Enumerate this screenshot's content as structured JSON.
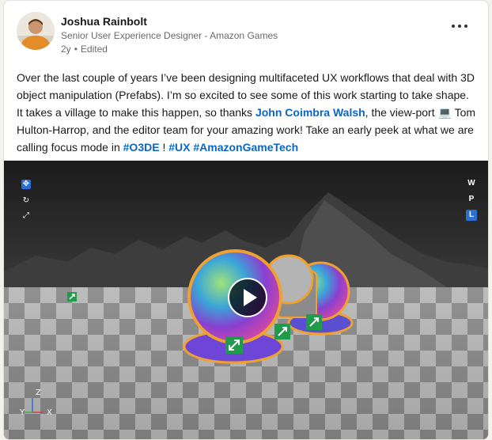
{
  "post": {
    "author_name": "Joshua Rainbolt",
    "author_title": "Senior User Experience Designer - Amazon Games",
    "age": "2y",
    "edited": "Edited",
    "meta_separator": "•",
    "more_menu_icon": "ellipsis-icon",
    "text": {
      "p1": "Over the last couple of years I’ve been designing multifaceted UX workflows that deal with 3D object manipulation (Prefabs). I’m so excited to see some of this work starting to take shape. It takes a village to make this happen, so thanks ",
      "mention1": "John Coimbra Walsh",
      "p2": ", the view-port ",
      "laptop_emoji": "💻",
      "p3": " Tom Hulton-Harrop, and the editor team for your amazing  work! Take an early peek at what we are calling focus mode in ",
      "hashtag1": "#O3DE",
      "p4": " ! ",
      "hashtag2": "#UX",
      "p5": " ",
      "hashtag3": "#AmazonGameTech"
    }
  },
  "video": {
    "play_icon": "play-icon",
    "viewport_modes": [
      "W",
      "P",
      "L"
    ],
    "axis": {
      "z": "Z",
      "y": "Y",
      "x": "X"
    },
    "colors": {
      "accent": "#0a66c2",
      "tool_blue": "#2a6fd6",
      "gizmo_green": "#1f9b4c",
      "outline_orange": "#f0a030"
    }
  }
}
